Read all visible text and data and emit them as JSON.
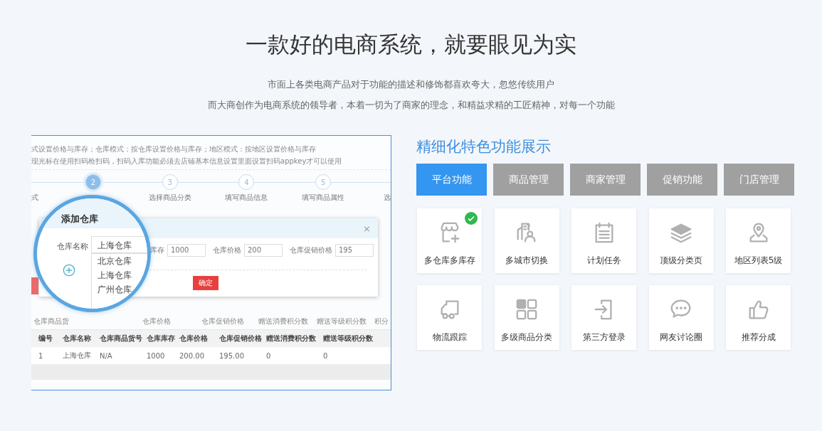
{
  "header": {
    "title": "一款好的电商系统，就要眼见为实",
    "lines": [
      "市面上各类电商产品对于功能的描述和修饰都喜欢夸大，忽悠传统用户",
      "而大商创作为电商系统的领导者，本着一切为了商家的理念，和精益求精的工匠精神，对每一个功能"
    ]
  },
  "screenshot": {
    "notes": [
      "式设置价格与库存；仓库模式：按仓库设置价格与库存；地区模式：按地区设置价格与库存",
      "现光标在使用扫码枪扫码，扫码入库功能必须去店铺基本信息设置里面设置扫码appkey才可以使用"
    ],
    "steps": [
      {
        "label": "式",
        "selected": false
      },
      {
        "number": "2",
        "selected": true
      },
      {
        "number": "3",
        "label": "选择商品分类",
        "selected": false
      },
      {
        "number": "4",
        "label": "填写商品信息",
        "selected": false
      },
      {
        "number": "5",
        "label": "填写商品属性",
        "selected": false
      },
      {
        "label": "选",
        "selected": false
      }
    ],
    "dialog": {
      "title": "添加仓库",
      "close": "×",
      "name_label": "仓库名称",
      "select_value": "上海仓库",
      "options": [
        "北京仓库",
        "上海仓库",
        "广州仓库"
      ],
      "fields": [
        {
          "label": "库存",
          "value": "1000"
        },
        {
          "label": "仓库价格",
          "value": "200"
        },
        {
          "label": "仓库促销价格",
          "value": "195"
        }
      ],
      "confirm": "确定"
    },
    "behind_columns": [
      "仓库商品货",
      "仓库价格",
      "仓库促销价格",
      "赠送消费积分数",
      "赠送等级积分数",
      "积分"
    ],
    "table": {
      "columns": [
        "编号",
        "仓库名称",
        "仓库商品货号",
        "仓库库存",
        "仓库价格",
        "仓库促销价格",
        "赠送消费积分数",
        "赠送等级积分数"
      ],
      "rows": [
        [
          "1",
          "上海仓库",
          "N/A",
          "1000",
          "200.00",
          "195.00",
          "0",
          "0"
        ]
      ]
    }
  },
  "features": {
    "title": "精细化特色功能展示",
    "tabs": [
      {
        "label": "平台功能",
        "selected": true
      },
      {
        "label": "商品管理",
        "selected": false
      },
      {
        "label": "商家管理",
        "selected": false
      },
      {
        "label": "促销功能",
        "selected": false
      },
      {
        "label": "门店管理",
        "selected": false
      }
    ],
    "items": [
      {
        "label": "多仓库多库存",
        "checked": true
      },
      {
        "label": "多城市切换",
        "checked": false
      },
      {
        "label": "计划任务",
        "checked": false
      },
      {
        "label": "顶级分类页",
        "checked": false
      },
      {
        "label": "地区列表5级",
        "checked": false
      },
      {
        "label": "物流跟踪",
        "checked": false
      },
      {
        "label": "多级商品分类",
        "checked": false
      },
      {
        "label": "第三方登录",
        "checked": false
      },
      {
        "label": "网友讨论圈",
        "checked": false
      },
      {
        "label": "推荐分成",
        "checked": false
      }
    ]
  }
}
